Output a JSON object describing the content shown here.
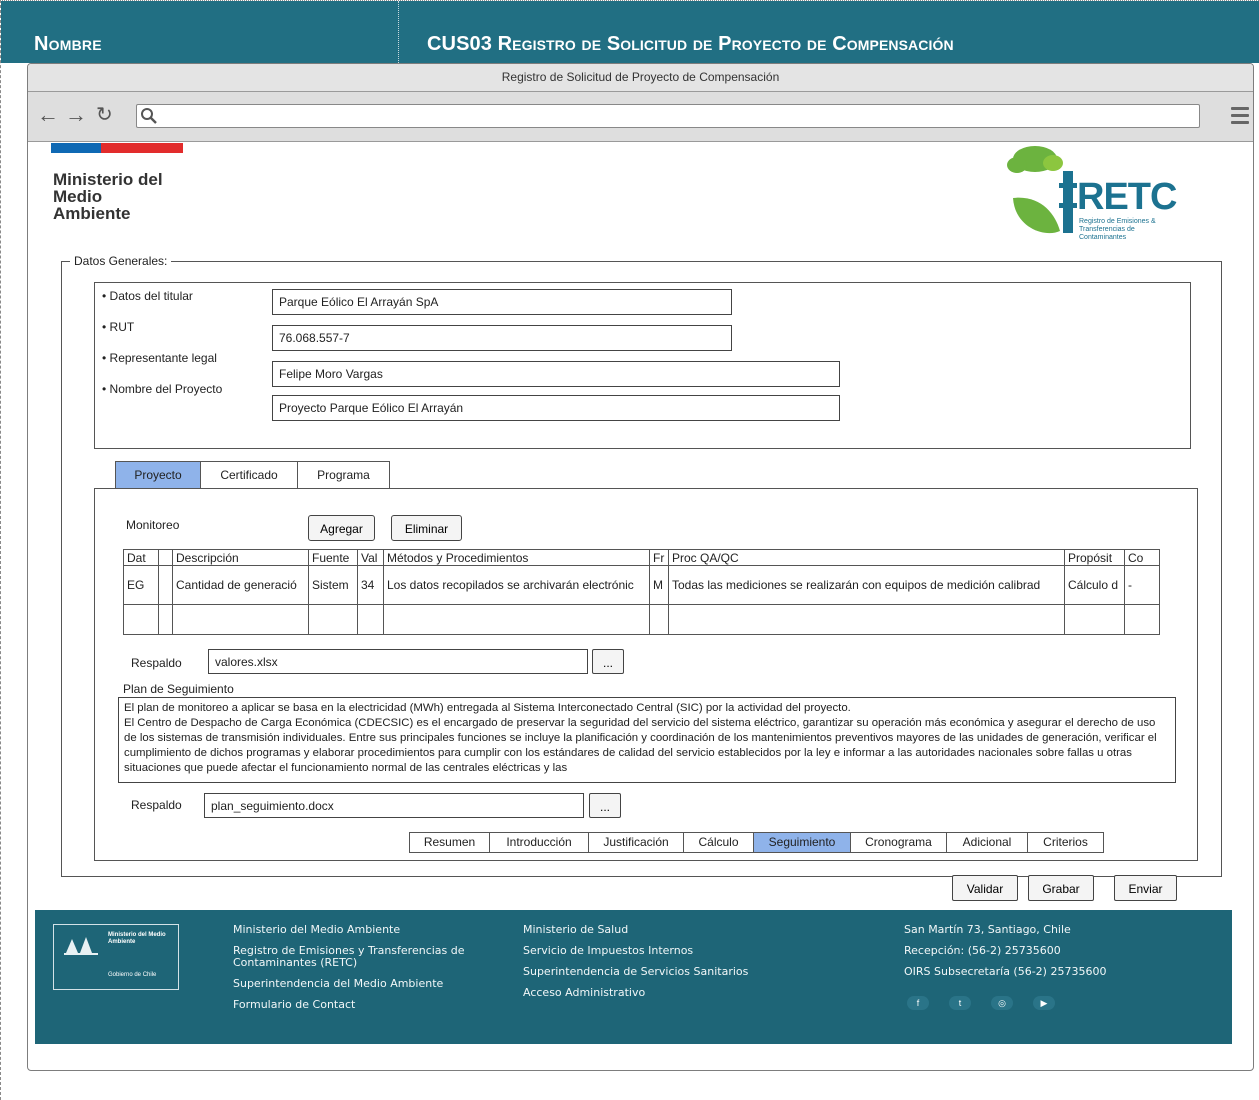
{
  "header": {
    "left_label": "Nombre",
    "right_label": "CUS03 Registro de Solicitud de Proyecto de Compensación"
  },
  "window": {
    "title": "Registro de Solicitud  de Proyecto de Compensación"
  },
  "browser": {
    "back_icon": "arrow-left-icon",
    "forward_icon": "arrow-right-icon",
    "reload_icon": "reload-icon",
    "search_icon": "search-icon",
    "menu_icon": "hamburger-menu-icon",
    "url": ""
  },
  "branding": {
    "ministry": "Ministerio del\nMedio\nAmbiente",
    "retc_word": "RETC",
    "retc_sub": "Registro de Emisiones & Transferencias de Contaminantes"
  },
  "general": {
    "legend": "Datos Generales:",
    "fields": [
      {
        "label": "• Datos del titular",
        "value": "Parque Eólico El Arrayán SpA"
      },
      {
        "label": "• RUT",
        "value": "76.068.557-7"
      },
      {
        "label": "• Representante legal",
        "value": "Felipe Moro Vargas"
      },
      {
        "label": "• Nombre del Proyecto",
        "value": "Proyecto Parque Eólico El Arrayán"
      }
    ]
  },
  "tabs": [
    "Proyecto",
    "Certificado",
    "Programa"
  ],
  "monitoring": {
    "label": "Monitoreo",
    "add_button": "Agregar",
    "delete_button": "Eliminar",
    "columns": [
      "Dat",
      "",
      "Descripción",
      "Fuente",
      "Val",
      "Métodos y Procedimientos",
      "Fr",
      "Proc QA/QC",
      "Propósit",
      "Co"
    ],
    "rows": [
      [
        "EG",
        "",
        "Cantidad de generació",
        "Sistem",
        "34",
        "Los datos recopilados se archivarán electrónic",
        "M",
        "Todas las mediciones se realizarán con equipos de medición calibrad",
        "Cálculo d",
        "-"
      ]
    ]
  },
  "respaldo1": {
    "label": "Respaldo",
    "value": "valores.xlsx",
    "browse": "..."
  },
  "plan": {
    "label": "Plan de Seguimiento",
    "text_lines": [
      "El plan de monitoreo a aplicar se basa en la electricidad (MWh) entregada al Sistema Interconectado Central (SIC) por la actividad del proyecto.",
      "El Centro de Despacho de Carga Económica (CDECSIC) es el encargado de preservar la seguridad del servicio del sistema eléctrico, garantizar su operación más económica y asegurar el derecho de uso de los sistemas de transmisión individuales. Entre sus principales funciones se incluye la planificación y coordinación de los mantenimientos preventivos mayores de las unidades de generación, verificar el cumplimiento de dichos programas y elaborar procedimientos para cumplir con los estándares de calidad del servicio establecidos por la ley e informar a las autoridades nacionales sobre fallas u otras situaciones que puede afectar el funcionamiento normal de las centrales eléctricas y las"
    ]
  },
  "respaldo2": {
    "label": "Respaldo",
    "value": "plan_seguimiento.docx",
    "browse": "..."
  },
  "subtabs": [
    "Resumen",
    "Introducción",
    "Justificación",
    "Cálculo",
    "Seguimiento",
    "Cronograma",
    "Adicional",
    "Criterios"
  ],
  "actions": {
    "validate": "Validar",
    "save": "Grabar",
    "send": "Enviar"
  },
  "footer": {
    "logo_title": "Ministerio del Medio Ambiente",
    "logo_sub": "Gobierno de Chile",
    "col1": [
      "Ministerio del Medio Ambiente",
      "Registro de Emisiones y Transferencias de Contaminantes (RETC)",
      "Superintendencia del Medio Ambiente",
      "Formulario de Contact"
    ],
    "col2": [
      "Ministerio de Salud",
      "Servicio de Impuestos Internos",
      "Superintendencia de Servicios Sanitarios",
      "Acceso Administrativo"
    ],
    "col3": [
      "San Martín 73, Santiago, Chile",
      "Recepción: (56-2) 25735600",
      "OIRS Subsecretaría (56-2) 25735600"
    ],
    "social": [
      "f",
      "t",
      "◎",
      "▶"
    ]
  }
}
